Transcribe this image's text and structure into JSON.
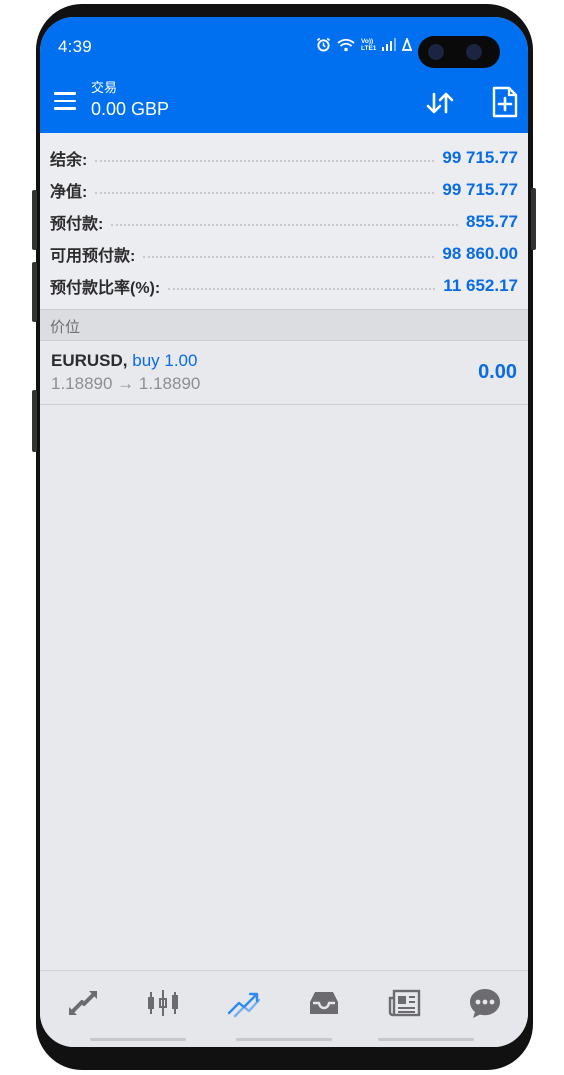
{
  "status_bar": {
    "time": "4:39",
    "network_label_top": "Vo))",
    "network_label_bottom": "LTE1"
  },
  "app_bar": {
    "title": "交易",
    "subtitle": "0.00 GBP"
  },
  "account": [
    {
      "label": "结余:",
      "value": "99 715.77"
    },
    {
      "label": "净值:",
      "value": "99 715.77"
    },
    {
      "label": "预付款:",
      "value": "855.77"
    },
    {
      "label": "可用预付款:",
      "value": "98 860.00"
    },
    {
      "label": "预付款比率(%):",
      "value": "11 652.17"
    }
  ],
  "positions_section": {
    "title": "价位"
  },
  "position": {
    "symbol": "EURUSD,",
    "side": "buy 1.00",
    "prices": "1.18890 → 1.18890",
    "profit": "0.00"
  },
  "bottom_nav": {
    "items": [
      "quotes-icon",
      "chart-icon",
      "trade-icon",
      "history-icon",
      "news-icon",
      "messages-icon"
    ],
    "active_index": 2
  },
  "colors": {
    "header_blue": "#0070f0",
    "value_blue": "#0a6ce0",
    "nav_gray": "#6b6b70",
    "nav_active": "#2f8bf0"
  }
}
